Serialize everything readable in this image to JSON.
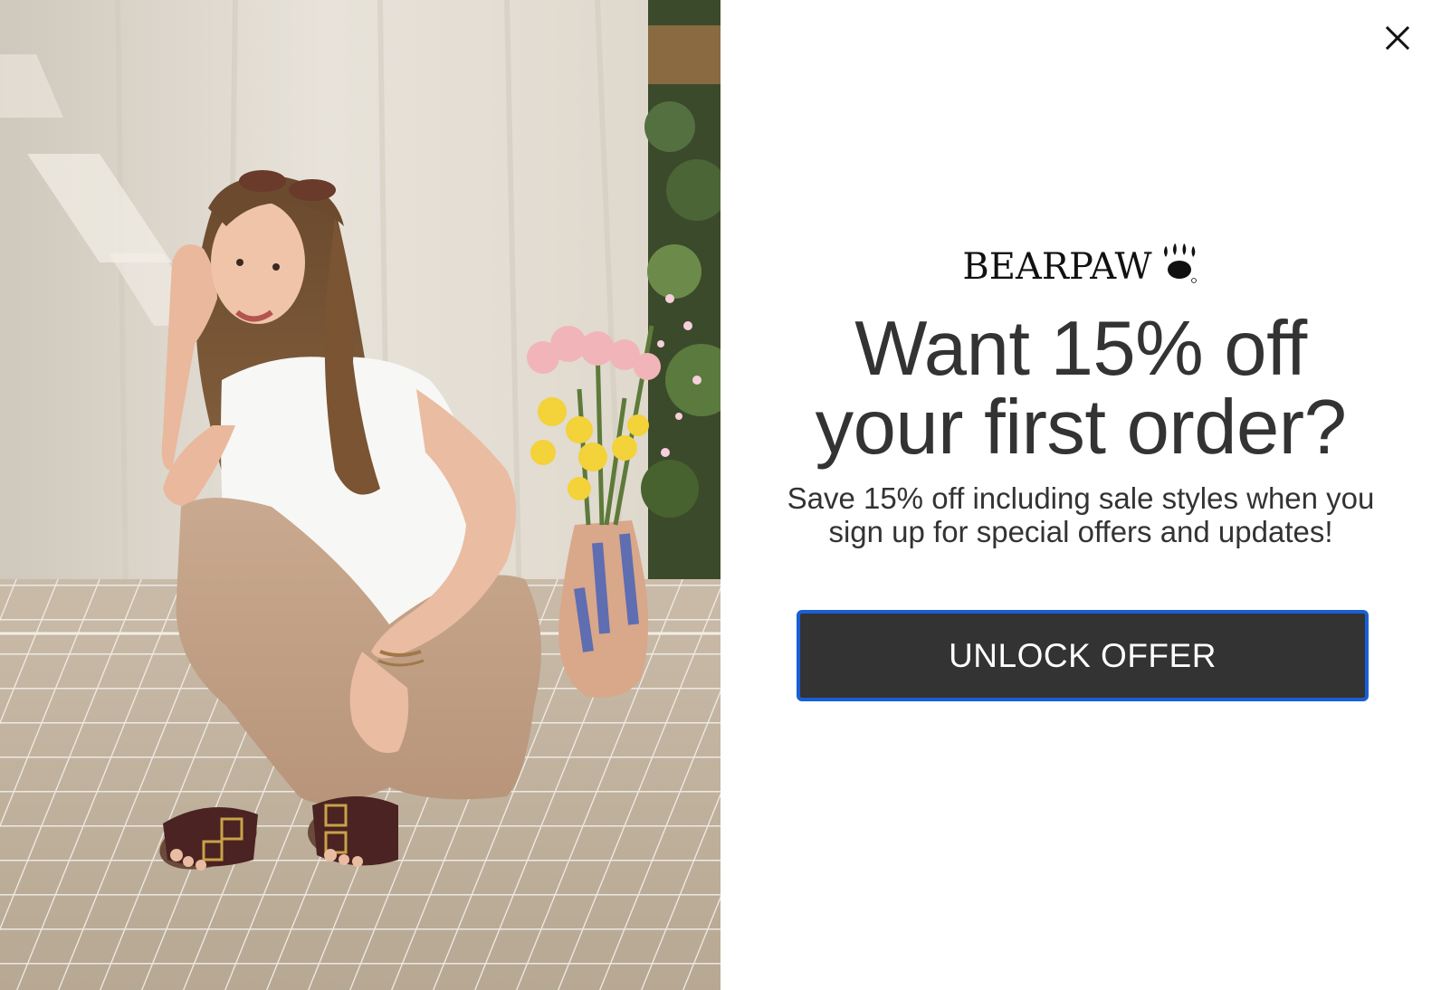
{
  "modal": {
    "photo_alt": "Woman sitting on tiled floor wearing brown buckle sandals next to a vase of flowers",
    "close_label": "×",
    "brand": {
      "name": "BEARPAW"
    },
    "headline_line1": "Want 15% off",
    "headline_line2": "your first order?",
    "subtext": "Save 15% off including sale styles when you sign up for special offers and updates!",
    "cta_label": "UNLOCK OFFER"
  },
  "colors": {
    "text": "#333333",
    "button_bg": "#333333",
    "button_text": "#ffffff",
    "button_focus_border": "#1a5fd6",
    "background": "#ffffff"
  },
  "icons": {
    "close": "close-icon",
    "paw": "paw-icon"
  }
}
